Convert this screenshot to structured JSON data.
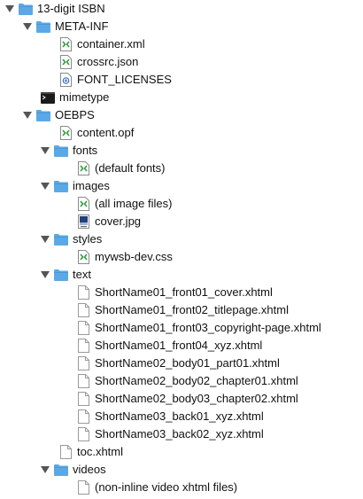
{
  "tree": {
    "items": [
      {
        "label": "13-digit ISBN",
        "icon": "folder-icon",
        "expanded": true
      },
      {
        "label": "META-INF",
        "icon": "folder-icon",
        "expanded": true
      },
      {
        "label": "container.xml",
        "icon": "xml-file-icon"
      },
      {
        "label": "crossrc.json",
        "icon": "xml-file-icon"
      },
      {
        "label": "FONT_LICENSES",
        "icon": "text-file-icon"
      },
      {
        "label": "mimetype",
        "icon": "terminal-file-icon"
      },
      {
        "label": "OEBPS",
        "icon": "folder-icon",
        "expanded": true
      },
      {
        "label": "content.opf",
        "icon": "xml-file-icon"
      },
      {
        "label": "fonts",
        "icon": "folder-icon",
        "expanded": true
      },
      {
        "label": "(default fonts)",
        "icon": "xml-file-icon"
      },
      {
        "label": "images",
        "icon": "folder-icon",
        "expanded": true
      },
      {
        "label": "(all image files)",
        "icon": "xml-file-icon"
      },
      {
        "label": "cover.jpg",
        "icon": "image-file-icon"
      },
      {
        "label": "styles",
        "icon": "folder-icon",
        "expanded": true
      },
      {
        "label": "mywsb-dev.css",
        "icon": "xml-file-icon"
      },
      {
        "label": "text",
        "icon": "folder-icon",
        "expanded": true
      },
      {
        "label": "ShortName01_front01_cover.xhtml",
        "icon": "blank-file-icon"
      },
      {
        "label": "ShortName01_front02_titlepage.xhtml",
        "icon": "blank-file-icon"
      },
      {
        "label": "ShortName01_front03_copyright-page.xhtml",
        "icon": "blank-file-icon"
      },
      {
        "label": "ShortName01_front04_xyz.xhtml",
        "icon": "blank-file-icon"
      },
      {
        "label": "ShortName02_body01_part01.xhtml",
        "icon": "blank-file-icon"
      },
      {
        "label": "ShortName02_body02_chapter01.xhtml",
        "icon": "blank-file-icon"
      },
      {
        "label": "ShortName02_body03_chapter02.xhtml",
        "icon": "blank-file-icon"
      },
      {
        "label": "ShortName03_back01_xyz.xhtml",
        "icon": "blank-file-icon"
      },
      {
        "label": "ShortName03_back02_xyz.xhtml",
        "icon": "blank-file-icon"
      },
      {
        "label": "toc.xhtml",
        "icon": "blank-file-icon"
      },
      {
        "label": "videos",
        "icon": "folder-icon",
        "expanded": true
      },
      {
        "label": "(non-inline video xhtml files)",
        "icon": "blank-file-icon"
      }
    ]
  },
  "colors": {
    "folder": "#5aa9e6",
    "folder_tab": "#4a98d6",
    "xml_green": "#2e9e3a",
    "terminal": "#1a1a1a",
    "disclosure": "#555555"
  }
}
